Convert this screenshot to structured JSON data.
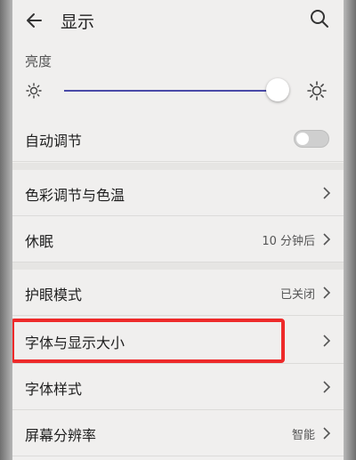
{
  "header": {
    "title": "显示",
    "back_icon": "back-arrow-icon",
    "search_icon": "search-icon"
  },
  "brightness": {
    "label": "亮度",
    "level_percent": 92
  },
  "rows": [
    {
      "label": "自动调节",
      "type": "toggle",
      "on": false
    },
    {
      "label": "色彩调节与色温",
      "type": "link"
    },
    {
      "label": "休眠",
      "value": "10 分钟后",
      "type": "link"
    },
    {
      "label": "护眼模式",
      "value": "已关闭",
      "type": "link"
    },
    {
      "label": "字体与显示大小",
      "type": "link"
    },
    {
      "label": "字体样式",
      "type": "link"
    },
    {
      "label": "屏幕分辨率",
      "value": "智能",
      "type": "link"
    }
  ],
  "colors": {
    "accent": "#4a4aa8",
    "highlight": "#ee2a2a"
  }
}
